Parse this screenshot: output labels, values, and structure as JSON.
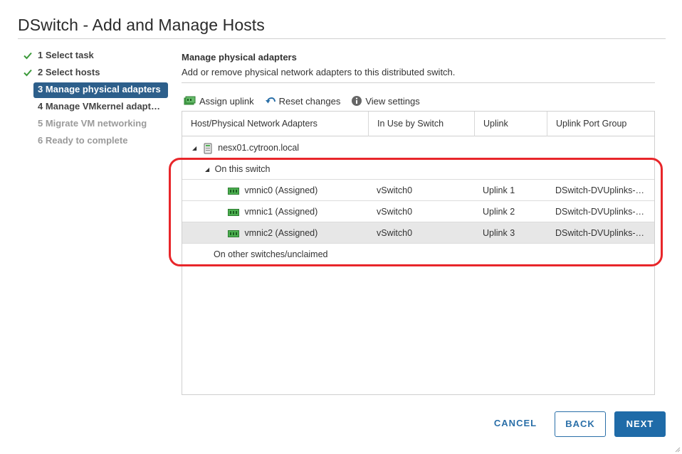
{
  "dialog": {
    "title": "DSwitch - Add and Manage Hosts"
  },
  "steps": [
    {
      "label": "1 Select task",
      "state": "done"
    },
    {
      "label": "2 Select hosts",
      "state": "done"
    },
    {
      "label": "3 Manage physical adapters",
      "state": "active"
    },
    {
      "label": "4 Manage VMkernel adapt…",
      "state": "pending"
    },
    {
      "label": "5 Migrate VM networking",
      "state": "disabled"
    },
    {
      "label": "6 Ready to complete",
      "state": "disabled"
    }
  ],
  "main": {
    "title": "Manage physical adapters",
    "description": "Add or remove physical network adapters to this distributed switch."
  },
  "toolbar": {
    "assign_uplink": "Assign uplink",
    "reset_changes": "Reset changes",
    "view_settings": "View settings"
  },
  "grid": {
    "columns": [
      "Host/Physical Network Adapters",
      "In Use by Switch",
      "Uplink",
      "Uplink Port Group"
    ],
    "host": "nesx01.cytroon.local",
    "group_on_switch": "On this switch",
    "rows": [
      {
        "adapter": "vmnic0 (Assigned)",
        "switch": "vSwitch0",
        "uplink": "Uplink 1",
        "port_group": "DSwitch-DVUplinks-…"
      },
      {
        "adapter": "vmnic1 (Assigned)",
        "switch": "vSwitch0",
        "uplink": "Uplink 2",
        "port_group": "DSwitch-DVUplinks-…"
      },
      {
        "adapter": "vmnic2 (Assigned)",
        "switch": "vSwitch0",
        "uplink": "Uplink 3",
        "port_group": "DSwitch-DVUplinks-…"
      }
    ],
    "group_other": "On other switches/unclaimed"
  },
  "footer": {
    "cancel": "CANCEL",
    "back": "BACK",
    "next": "NEXT"
  },
  "colors": {
    "accent": "#1f6ba8",
    "active_step": "#2d5f8b",
    "check": "#3c9a3a",
    "highlight": "#e8262a"
  }
}
